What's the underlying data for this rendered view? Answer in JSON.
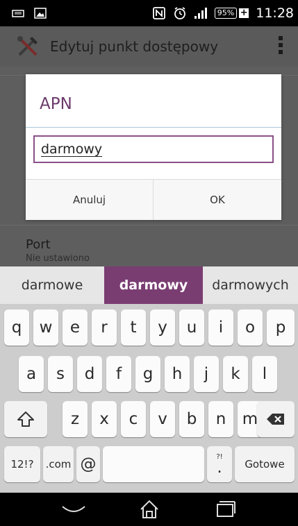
{
  "status": {
    "battery": "95%",
    "time": "11:28"
  },
  "actionbar": {
    "title": "Edytuj punkt dostępowy"
  },
  "settings": {
    "port_title": "Port",
    "port_value": "Nie ustawiono"
  },
  "dialog": {
    "title": "APN",
    "input_value": "darmowy",
    "cancel_label": "Anuluj",
    "ok_label": "OK"
  },
  "suggestions": [
    "darmowe",
    "darmowy",
    "darmowych"
  ],
  "keyboard": {
    "row1": [
      "q",
      "w",
      "e",
      "r",
      "t",
      "y",
      "u",
      "i",
      "o",
      "p"
    ],
    "row2": [
      "a",
      "s",
      "d",
      "f",
      "g",
      "h",
      "j",
      "k",
      "l"
    ],
    "row3": [
      "z",
      "x",
      "c",
      "v",
      "b",
      "n",
      "m"
    ],
    "symbols_label": "12!?",
    "com_label": ".com",
    "at_label": "@",
    "punct_label": ".",
    "punct_hint": "?!",
    "done_label": "Gotowe"
  },
  "colors": {
    "accent": "#7a3d72",
    "dialog_title": "#6b3a6b",
    "input_border": "#8a4f87"
  }
}
